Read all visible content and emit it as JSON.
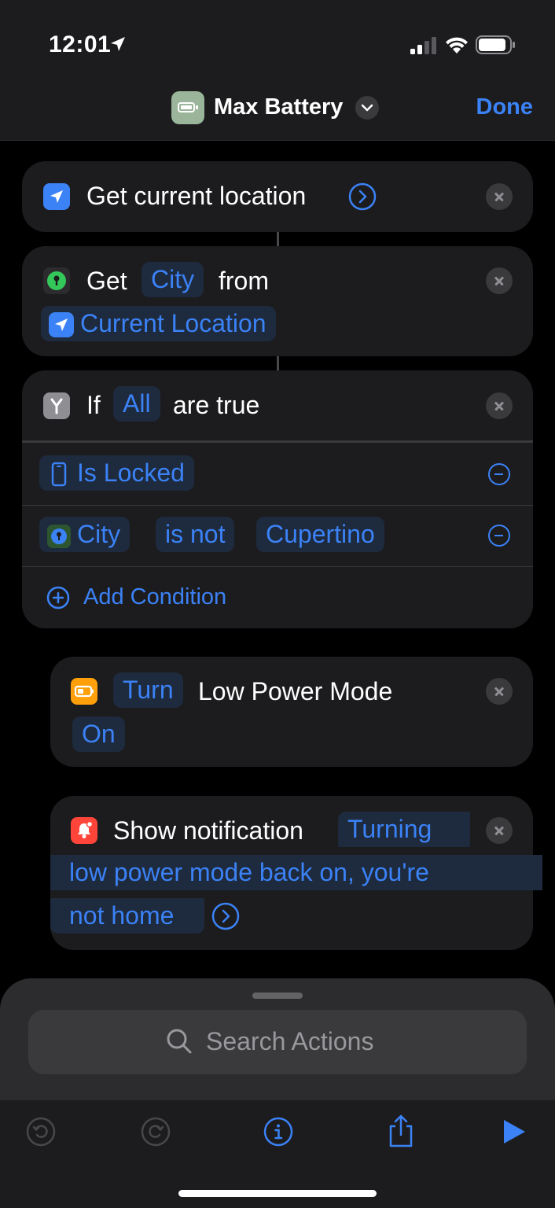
{
  "status_bar": {
    "time": "12:01"
  },
  "nav": {
    "title": "Max Battery",
    "done_label": "Done"
  },
  "actions": {
    "get_location": {
      "label": "Get current location"
    },
    "get_city": {
      "label_get": "Get",
      "property": "City",
      "label_from": "from",
      "source": "Current Location"
    },
    "if_block": {
      "label_if": "If",
      "quantifier": "All",
      "label_are_true": "are true",
      "conditions": [
        {
          "subject": "Is Locked"
        },
        {
          "subject": "City",
          "operator": "is not",
          "value": "Cupertino"
        }
      ],
      "add_condition_label": "Add Condition"
    },
    "low_power": {
      "verb": "Turn",
      "label": "Low Power Mode",
      "state": "On"
    },
    "notification": {
      "label": "Show notification",
      "text_line1": "Turning",
      "text_line2": "low power mode back on, you're",
      "text_line3": "not home"
    }
  },
  "search": {
    "placeholder": "Search Actions"
  },
  "colors": {
    "accent": "#3b82f6",
    "card": "#1c1c1e",
    "background": "#000000"
  }
}
